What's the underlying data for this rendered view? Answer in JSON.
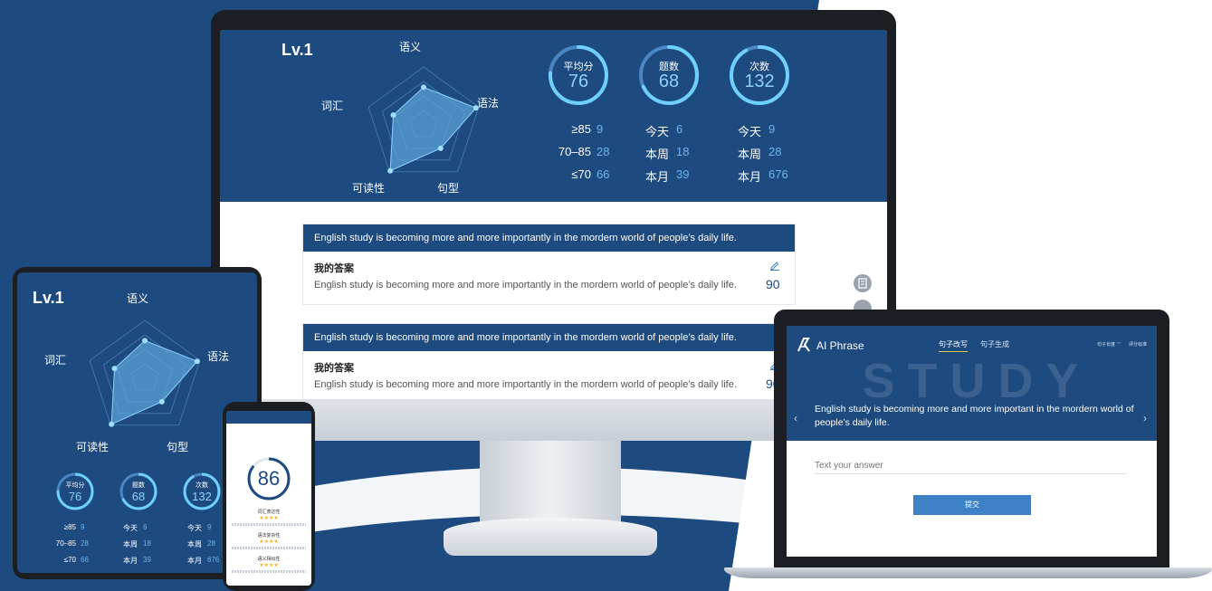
{
  "colors": {
    "brand": "#1d4a7f",
    "accent": "#6fb4ee",
    "star": "#f2b61c",
    "button": "#3d82c6"
  },
  "stats": {
    "level": "Lv.1",
    "radar_axes": [
      "语义",
      "语法",
      "句型",
      "可读性",
      "词汇"
    ],
    "rings": [
      {
        "label": "平均分",
        "value": "76",
        "fraction": 0.76
      },
      {
        "label": "题数",
        "value": "68",
        "fraction": 0.68
      },
      {
        "label": "次数",
        "value": "132",
        "fraction": 0.92
      }
    ],
    "score_rows": [
      {
        "label": "≥85",
        "value": "9"
      },
      {
        "label": "70–85",
        "value": "28"
      },
      {
        "label": "≤70",
        "value": "66"
      }
    ],
    "count_rows": [
      {
        "label": "今天",
        "value": "6"
      },
      {
        "label": "本周",
        "value": "18"
      },
      {
        "label": "本月",
        "value": "39"
      }
    ],
    "times_rows": [
      {
        "label": "今天",
        "value": "9"
      },
      {
        "label": "本周",
        "value": "28"
      },
      {
        "label": "本月",
        "value": "676"
      }
    ]
  },
  "monitor": {
    "cards": [
      {
        "prompt": "English study is becoming more and more importantly in the mordern world of people’s daily life.",
        "answer_title": "我的答案",
        "answer": "English study is becoming more and more importantly in the mordern world of people’s daily life.",
        "score": "90"
      },
      {
        "prompt": "English study is becoming more and more importantly in the mordern world of people’s daily life.",
        "answer_title": "我的答案",
        "answer": "English study is becoming more and more importantly in the mordern world of people’s daily life.",
        "score": "90"
      }
    ]
  },
  "phone": {
    "score": "86",
    "score_fraction": 0.86,
    "sections": [
      {
        "title": "词汇表达性",
        "stars": 4
      },
      {
        "title": "语法复杂性",
        "stars": 4
      },
      {
        "title": "语义相似性",
        "stars": 4
      }
    ]
  },
  "laptop": {
    "brand": "AI Phrase",
    "tabs": [
      "句子改写",
      "句子生成"
    ],
    "right_links": [
      "句子长度 ﹀",
      "评分标准"
    ],
    "banner_word": "STUDY",
    "prompt": "English study is becoming more and more important in the mordern world of people’s daily life.",
    "input_placeholder": "Text your answer",
    "submit_label": "提交"
  }
}
